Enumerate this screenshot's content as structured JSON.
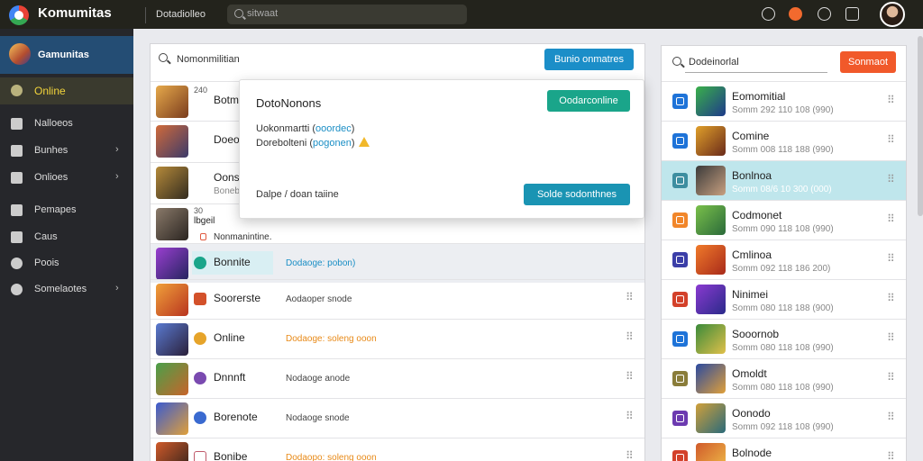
{
  "app": {
    "title": "Komumitas"
  },
  "topbar": {
    "link": "Dotadiolleo",
    "search_placeholder": "sitwaat"
  },
  "sidebar": {
    "header": "Gamunitas",
    "active": "Online",
    "items": [
      {
        "label": "Nalloeos",
        "icon": "notes-icon",
        "chevron": ""
      },
      {
        "label": "Bunhes",
        "icon": "people-icon",
        "chevron": "›"
      },
      {
        "label": "Onlioes",
        "icon": "grid-icon",
        "chevron": "›"
      },
      {
        "label": "Pemapes",
        "icon": "bookmark-icon",
        "chevron": ""
      },
      {
        "label": "Caus",
        "icon": "chart-icon",
        "chevron": ""
      },
      {
        "label": "Poois",
        "icon": "clock-icon",
        "chevron": ""
      },
      {
        "label": "Somelaotes",
        "icon": "gear-icon",
        "chevron": "›"
      }
    ]
  },
  "main": {
    "search_label": "Nomonmilitian",
    "action_button": "Bunio onmatres",
    "partial_rows": [
      {
        "num": "240",
        "name": "Botmoa"
      },
      {
        "num": "",
        "name": "Doeo"
      },
      {
        "num": "",
        "name": "Oonsoo",
        "sub": "Bonebo"
      },
      {
        "num": "30",
        "name": "lbgeil"
      }
    ],
    "notice": "Nonmanintine.",
    "rows": [
      {
        "name": "Bonnite",
        "status": "Dodaoge: pobon)",
        "status_color": "blue"
      },
      {
        "name": "Soorerste",
        "status": "Aodaoper snode",
        "status_color": "normal"
      },
      {
        "name": "Online",
        "status": "Dodaoge: soleng ooon",
        "status_color": "orange"
      },
      {
        "name": "Dnnnft",
        "status": "Nodaoge anode",
        "status_color": "normal"
      },
      {
        "name": "Borenote",
        "status": "Nodaoge snode",
        "status_color": "normal"
      },
      {
        "name": "Bonibe",
        "status": "Dodaopo: soleng ooon",
        "status_color": "orange"
      }
    ]
  },
  "modal": {
    "title": "DotoNonons",
    "primary_button": "Oodarconline",
    "line1_text": "Uokonmartti",
    "line1_link": "ooordec",
    "line2_text": "Dorebolteni",
    "line2_link": "pogonen",
    "footer_text": "Dalpe / doan taiine",
    "secondary_button": "Solde sodonthnes"
  },
  "right_panel": {
    "search_label": "Dodeinorlal",
    "button": "Sonmaot",
    "items": [
      {
        "name": "Eomomitial",
        "meta": "Somm 292 110 108 (990)",
        "color": "#1e73d8"
      },
      {
        "name": "Comine",
        "meta": "Somm 008 118 188 (990)",
        "color": "#1e73d8"
      },
      {
        "name": "Bonlnoa",
        "meta": "Somm 08/6 10 300 (000)",
        "color": "#3d8ea0"
      },
      {
        "name": "Codmonet",
        "meta": "Somm 090 118 108 (990)",
        "color": "#f1862a"
      },
      {
        "name": "Cmlinoa",
        "meta": "Somm 092 118 186 200)",
        "color": "#3b3ea8"
      },
      {
        "name": "Ninimei",
        "meta": "Somm 080 118 188 (900)",
        "color": "#d3412a"
      },
      {
        "name": "Sooornob",
        "meta": "Somm 080 118 108 (990)",
        "color": "#1e73d8"
      },
      {
        "name": "Omoldt",
        "meta": "Somm 080 118 108 (990)",
        "color": "#8a7d3a"
      },
      {
        "name": "Oonodo",
        "meta": "Somm 092 118 108 (990)",
        "color": "#6c3ab0"
      },
      {
        "name": "Bolnode",
        "meta": "",
        "color": "#d3412a"
      }
    ]
  }
}
